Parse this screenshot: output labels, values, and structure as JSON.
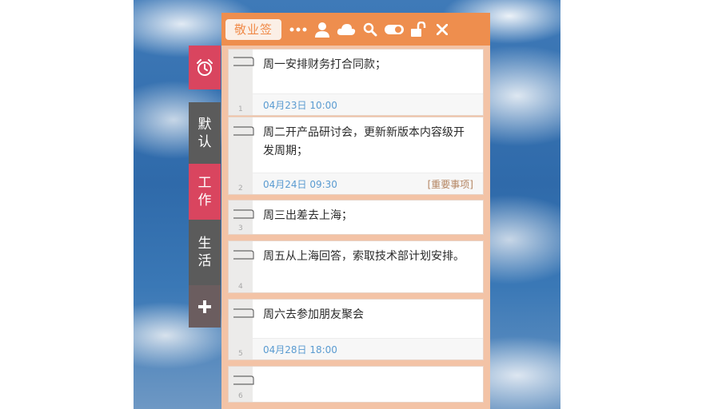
{
  "widget": {
    "brand": "敬业签",
    "header_icons": [
      "more-icon",
      "user-icon",
      "cloud-icon",
      "search-icon",
      "toggle-icon",
      "unlock-icon",
      "close-icon"
    ],
    "accent_color": "#ee8e4e",
    "background_color": "#f3c3a6"
  },
  "side_tabs": [
    {
      "name": "alarm-icon",
      "label": "",
      "color": "#d9455f"
    },
    {
      "name": "默认",
      "label": "默认",
      "color": "#5b5b5b"
    },
    {
      "name": "工作",
      "label": "工作",
      "color": "#d9455f"
    },
    {
      "name": "生活",
      "label": "生活",
      "color": "#5b5b5b"
    },
    {
      "name": "plus-icon",
      "label": "",
      "color": "#6b5d5f"
    }
  ],
  "notes": [
    {
      "number": "1",
      "text": "周一安排财务打合同款；",
      "time": "04月23日 10:00",
      "tag": ""
    },
    {
      "number": "2",
      "text": "周二开产品研讨会，更新新版本内容级开发周期；",
      "time": "04月24日 09:30",
      "tag": "[重要事项]"
    },
    {
      "number": "3",
      "text": "周三出差去上海；",
      "time": "",
      "tag": ""
    },
    {
      "number": "4",
      "text": "周五从上海回答，索取技术部计划安排。",
      "time": "",
      "tag": ""
    },
    {
      "number": "5",
      "text": "周六去参加朋友聚会",
      "time": "04月28日 18:00",
      "tag": ""
    },
    {
      "number": "6",
      "text": "",
      "time": "",
      "tag": ""
    }
  ]
}
